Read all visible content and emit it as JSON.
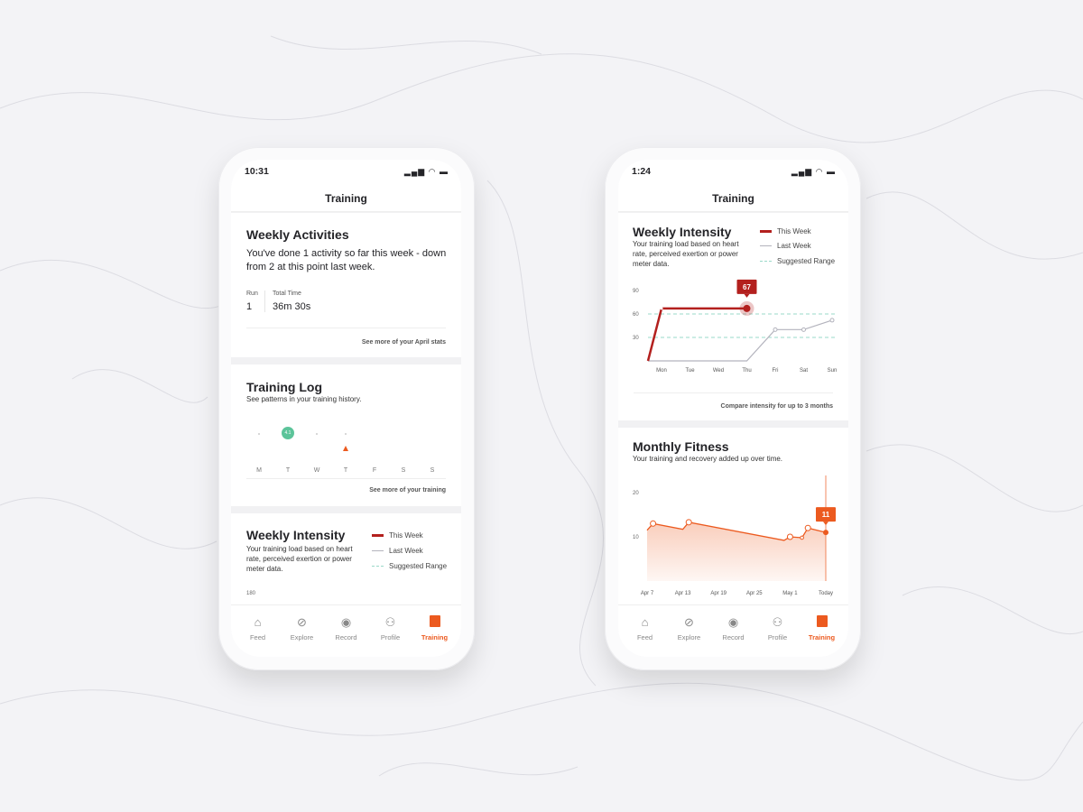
{
  "colors": {
    "accent": "#ec5a1f",
    "this_week": "#b3201e",
    "last_week": "#b3b3bd",
    "suggested": "#9ad8c9",
    "log_green": "#5cc49a"
  },
  "left_phone": {
    "status": {
      "time": "10:31"
    },
    "title": "Training",
    "weekly_activities": {
      "title": "Weekly Activities",
      "text": "You've done 1 activity so far this week - down from 2 at this point last week.",
      "stats": [
        {
          "label": "Run",
          "value": "1"
        },
        {
          "label": "Total Time",
          "value": "36m 30s"
        }
      ],
      "link": "See more of your April stats"
    },
    "training_log": {
      "title": "Training Log",
      "subtitle": "See patterns in your training history.",
      "days": [
        "M",
        "T",
        "W",
        "T",
        "F",
        "S",
        "S"
      ],
      "activity_value": "4.1",
      "link": "See more of your training"
    },
    "weekly_intensity": {
      "title": "Weekly Intensity",
      "subtitle": "Your training load based on heart rate, perceived exertion or power meter data.",
      "legend": [
        "This Week",
        "Last Week",
        "Suggested Range"
      ],
      "y_top_tick": "180"
    }
  },
  "right_phone": {
    "status": {
      "time": "1:24"
    },
    "title": "Training",
    "weekly_intensity": {
      "title": "Weekly Intensity",
      "subtitle": "Your training load based on heart rate, perceived exertion or power meter data.",
      "legend": [
        "This Week",
        "Last Week",
        "Suggested Range"
      ],
      "link": "Compare intensity for up to 3 months",
      "tooltip": "67"
    },
    "monthly_fitness": {
      "title": "Monthly Fitness",
      "subtitle": "Your training and recovery added up over time.",
      "tooltip": "11"
    }
  },
  "tabs": [
    {
      "label": "Feed",
      "icon": "home-icon"
    },
    {
      "label": "Explore",
      "icon": "compass-icon"
    },
    {
      "label": "Record",
      "icon": "record-icon"
    },
    {
      "label": "Profile",
      "icon": "profile-icon"
    },
    {
      "label": "Training",
      "icon": "calendar-chart-icon",
      "active": true
    }
  ],
  "chart_data": [
    {
      "type": "line",
      "title": "Weekly Intensity",
      "categories": [
        "Mon",
        "Tue",
        "Wed",
        "Thu",
        "Fri",
        "Sat",
        "Sun"
      ],
      "yticks": [
        30,
        60,
        90
      ],
      "ylim": [
        0,
        90
      ],
      "series": [
        {
          "name": "This Week",
          "values": [
            67,
            67,
            67,
            67
          ]
        },
        {
          "name": "Last Week",
          "values": [
            0,
            0,
            0,
            0,
            40,
            40,
            52
          ]
        }
      ],
      "start_value": 0,
      "suggested_range": [
        30,
        60
      ],
      "legend": "top-right",
      "highlight": {
        "category": "Thu",
        "value": 67
      }
    },
    {
      "type": "area",
      "title": "Monthly Fitness",
      "xtick_labels": [
        "Apr 7",
        "Apr 13",
        "Apr 19",
        "Apr 25",
        "May 1",
        "Today"
      ],
      "yticks": [
        10,
        20
      ],
      "ylim": [
        0,
        20
      ],
      "points": [
        {
          "x": "Apr 7",
          "y": 11.5
        },
        {
          "x": "Apr 8",
          "y": 13,
          "marker": true
        },
        {
          "x": "Apr 13",
          "y": 11.7
        },
        {
          "x": "Apr 14",
          "y": 13.3,
          "marker": true
        },
        {
          "x": "Apr 30",
          "y": 9.2
        },
        {
          "x": "May 1",
          "y": 10,
          "marker": true
        },
        {
          "x": "May 3",
          "y": 9.8,
          "marker": true
        },
        {
          "x": "May 4",
          "y": 12,
          "marker": true
        },
        {
          "x": "Today",
          "y": 11
        }
      ],
      "highlight": {
        "x": "Today",
        "value": 11
      }
    }
  ]
}
